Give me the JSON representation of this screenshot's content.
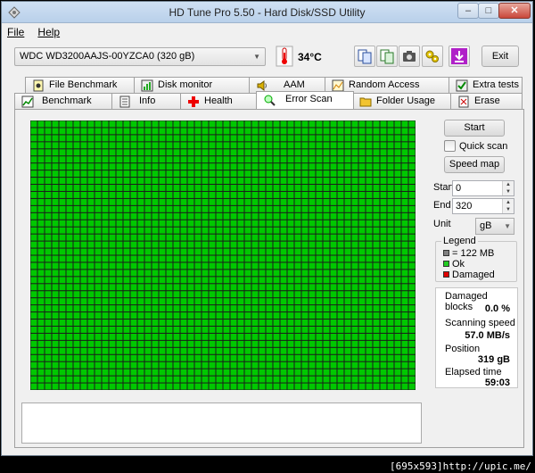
{
  "window": {
    "title": "HD Tune Pro 5.50 - Hard Disk/SSD Utility"
  },
  "menu": {
    "file": "File",
    "help": "Help"
  },
  "toolbar": {
    "drive": "WDC WD3200AAJS-00YZCA0 (320 gB)",
    "temperature": "34°C",
    "exit": "Exit"
  },
  "tabs_top": [
    {
      "label": "File Benchmark",
      "icon": "file-benchmark-icon"
    },
    {
      "label": "Disk monitor",
      "icon": "disk-monitor-icon"
    },
    {
      "label": "AAM",
      "icon": "speaker-icon"
    },
    {
      "label": "Random Access",
      "icon": "random-access-icon"
    },
    {
      "label": "Extra tests",
      "icon": "extra-tests-icon"
    }
  ],
  "tabs_bottom": [
    {
      "label": "Benchmark",
      "icon": "benchmark-icon"
    },
    {
      "label": "Info",
      "icon": "info-icon"
    },
    {
      "label": "Health",
      "icon": "health-cross-icon"
    },
    {
      "label": "Error Scan",
      "icon": "magnifier-icon",
      "active": true
    },
    {
      "label": "Folder Usage",
      "icon": "folder-icon"
    },
    {
      "label": "Erase",
      "icon": "erase-icon"
    }
  ],
  "error_scan": {
    "start_button": "Start",
    "quick_scan_label": "Quick scan",
    "quick_scan_checked": false,
    "speed_map_button": "Speed map",
    "start_label": "Start",
    "start_value": "0",
    "end_label": "End",
    "end_value": "320",
    "unit_label": "Unit",
    "unit_value": "gB",
    "legend": {
      "title": "Legend",
      "items": [
        {
          "label": "= 122 MB",
          "color": "#808080"
        },
        {
          "label": "Ok",
          "color": "#22cc22"
        },
        {
          "label": "Damaged",
          "color": "#e00000"
        }
      ]
    },
    "stats": {
      "damaged_blocks_label": "Damaged blocks",
      "damaged_blocks_value": "0.0 %",
      "scanning_speed_label": "Scanning speed",
      "scanning_speed_value": "57.0 MB/s",
      "position_label": "Position",
      "position_value": "319 gB",
      "elapsed_label": "Elapsed time",
      "elapsed_value": "59:03"
    },
    "block_colors": {
      "ok": "#00c800",
      "border": "#1b1b1b"
    }
  },
  "watermark": "[695x593]http://upic.me/"
}
